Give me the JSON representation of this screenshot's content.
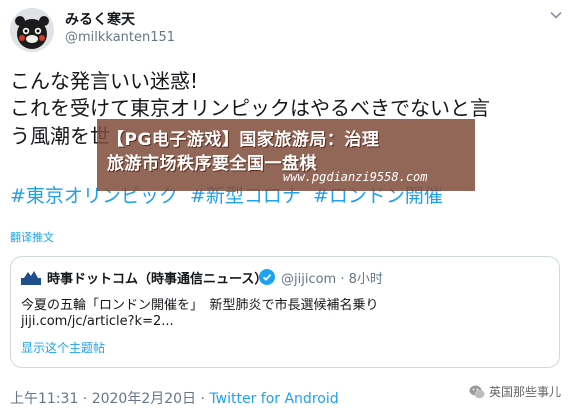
{
  "author": {
    "display_name": "みるく寒天",
    "handle": "@milkkanten151",
    "avatar_icon": "avatar-kumamon-icon"
  },
  "tweet": {
    "line1": "こんな発言いい迷惑!",
    "line2": "これを受けて東京オリンピックはやるべきでないと言",
    "line3": "う風潮を世"
  },
  "hashtags": [
    "#東京オリンピック",
    "#新型コロナ",
    "#ロンドン開催"
  ],
  "translate_label": "翻译推文",
  "quoted": {
    "name": "時事ドットコム（時事通信ニュース）",
    "handle_time": "@jijicom · 8小时",
    "text_line1": "今夏の五輪「ロンドン開催を」　新型肺炎で市長選候補名乗り",
    "text_line2": "jiji.com/jc/article?k=2...",
    "thread_link": "显示这个主题帖"
  },
  "footer": {
    "timestamp": "上午11:31 · 2020年2月20日 · ",
    "via": "Twitter for Android",
    "watermark": "英国那些事儿"
  },
  "overlay": {
    "title": "【PG电子游戏】国家旅游局：治理",
    "subtitle": "旅游市场秩序要全国一盘棋",
    "url": "www.pgdianzi9558.com"
  },
  "colors": {
    "link": "#1da1f2",
    "overlay_bg": "#804e3c"
  }
}
